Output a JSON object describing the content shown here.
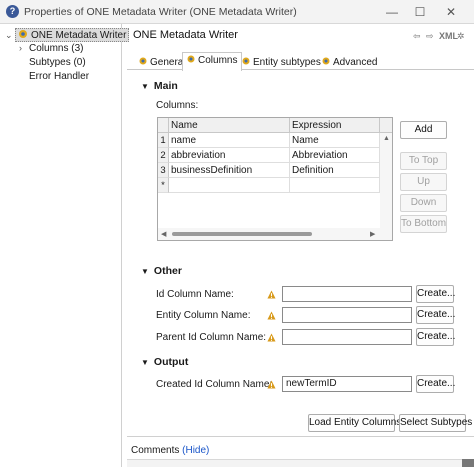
{
  "window": {
    "title": "Properties of ONE Metadata Writer (ONE Metadata Writer)",
    "minimize": "—",
    "maximize": "☐",
    "close": "✕"
  },
  "tree": {
    "root": "ONE Metadata Writer",
    "items": [
      {
        "label": "Columns (3)"
      },
      {
        "label": "Subtypes (0)"
      },
      {
        "label": "Error Handler"
      }
    ]
  },
  "pane": {
    "title": "ONE Metadata Writer",
    "xml_label": "XML",
    "tabs": [
      {
        "label": "General"
      },
      {
        "label": "Columns"
      },
      {
        "label": "Entity subtypes"
      },
      {
        "label": "Advanced"
      }
    ]
  },
  "main": {
    "heading": "Main",
    "columns_label": "Columns:",
    "table": {
      "headers": [
        "Name",
        "Expression"
      ],
      "rows": [
        {
          "num": "1",
          "name": "name",
          "expression": "Name"
        },
        {
          "num": "2",
          "name": "abbreviation",
          "expression": "Abbreviation"
        },
        {
          "num": "3",
          "name": "businessDefinition",
          "expression": "Definition"
        }
      ],
      "new_row_marker": "*"
    },
    "buttons": {
      "add": "Add",
      "to_top": "To Top",
      "up": "Up",
      "down": "Down",
      "to_bottom": "To Bottom"
    }
  },
  "other": {
    "heading": "Other",
    "fields": [
      {
        "label": "Id Column Name:",
        "value": "",
        "button": "Create..."
      },
      {
        "label": "Entity Column Name:",
        "value": "",
        "button": "Create..."
      },
      {
        "label": "Parent Id Column Name:",
        "value": "",
        "button": "Create..."
      }
    ]
  },
  "output": {
    "heading": "Output",
    "field": {
      "label": "Created Id Column Name:",
      "value": "newTermID",
      "button": "Create..."
    }
  },
  "footer": {
    "load_entity_columns": "Load Entity Columns",
    "select_subtypes": "Select Subtypes",
    "comments_label": "Comments",
    "comments_link": "(Hide)"
  },
  "colors": {
    "warning": "#d89a1a",
    "link": "#1a56c9",
    "selection": "#dcdcdc"
  },
  "icons": {
    "help": "help-icon",
    "node": "component-node-icon",
    "warning": "warning-icon"
  }
}
